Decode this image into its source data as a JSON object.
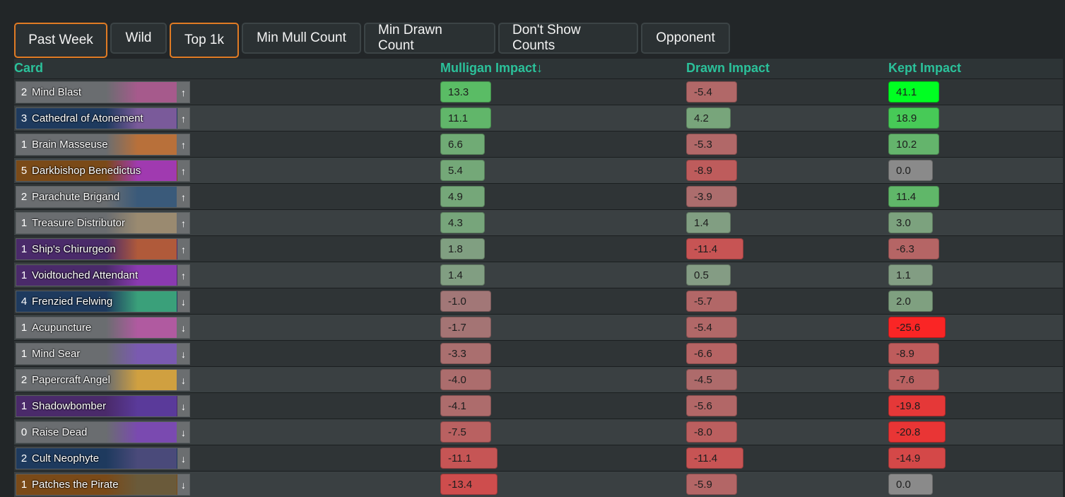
{
  "filters": [
    {
      "label": "Past Week",
      "active": true
    },
    {
      "label": "Wild",
      "active": false
    },
    {
      "label": "Top 1k",
      "active": true
    },
    {
      "label": "Min Mull Count",
      "active": false
    },
    {
      "label": "Min Drawn Count",
      "active": false
    },
    {
      "label": "Don't Show Counts",
      "active": false
    },
    {
      "label": "Opponent",
      "active": false
    }
  ],
  "headers": {
    "card": "Card",
    "mulligan": "Mulligan Impact↓",
    "drawn": "Drawn Impact",
    "kept": "Kept Impact"
  },
  "rows": [
    {
      "cost": "2",
      "name": "Mind Blast",
      "arrow": "↑",
      "card_bg": "#6a6d70",
      "art": "#a65a8c",
      "mulligan": "13.3",
      "drawn": "-5.4",
      "kept": "41.1"
    },
    {
      "cost": "3",
      "name": "Cathedral of Atonement",
      "arrow": "↑",
      "card_bg": "#1e3a5e",
      "art": "#7a5a9a",
      "mulligan": "11.1",
      "drawn": "4.2",
      "kept": "18.9"
    },
    {
      "cost": "1",
      "name": "Brain Masseuse",
      "arrow": "↑",
      "card_bg": "#6a6d70",
      "art": "#b8703a",
      "mulligan": "6.6",
      "drawn": "-5.3",
      "kept": "10.2"
    },
    {
      "cost": "5",
      "name": "Darkbishop Benedictus",
      "arrow": "↑",
      "card_bg": "#7a4a18",
      "art": "#a03ab0",
      "mulligan": "5.4",
      "drawn": "-8.9",
      "kept": "0.0"
    },
    {
      "cost": "2",
      "name": "Parachute Brigand",
      "arrow": "↑",
      "card_bg": "#6a6d70",
      "art": "#3a5a7a",
      "mulligan": "4.9",
      "drawn": "-3.9",
      "kept": "11.4"
    },
    {
      "cost": "1",
      "name": "Treasure Distributor",
      "arrow": "↑",
      "card_bg": "#6a6d70",
      "art": "#9a8a70",
      "mulligan": "4.3",
      "drawn": "1.4",
      "kept": "3.0"
    },
    {
      "cost": "1",
      "name": "Ship's Chirurgeon",
      "arrow": "↑",
      "card_bg": "#4a2a6a",
      "art": "#b05a3a",
      "mulligan": "1.8",
      "drawn": "-11.4",
      "kept": "-6.3"
    },
    {
      "cost": "1",
      "name": "Voidtouched Attendant",
      "arrow": "↑",
      "card_bg": "#4a2a6a",
      "art": "#8a3ab0",
      "mulligan": "1.4",
      "drawn": "0.5",
      "kept": "1.1"
    },
    {
      "cost": "4",
      "name": "Frenzied Felwing",
      "arrow": "↓",
      "card_bg": "#1e3a5e",
      "art": "#3aa07a",
      "mulligan": "-1.0",
      "drawn": "-5.7",
      "kept": "2.0"
    },
    {
      "cost": "1",
      "name": "Acupuncture",
      "arrow": "↓",
      "card_bg": "#6a6d70",
      "art": "#b05aa0",
      "mulligan": "-1.7",
      "drawn": "-5.4",
      "kept": "-25.6"
    },
    {
      "cost": "1",
      "name": "Mind Sear",
      "arrow": "↓",
      "card_bg": "#6a6d70",
      "art": "#7a5ab0",
      "mulligan": "-3.3",
      "drawn": "-6.6",
      "kept": "-8.9"
    },
    {
      "cost": "2",
      "name": "Papercraft Angel",
      "arrow": "↓",
      "card_bg": "#6a6d70",
      "art": "#d0a040",
      "mulligan": "-4.0",
      "drawn": "-4.5",
      "kept": "-7.6"
    },
    {
      "cost": "1",
      "name": "Shadowbomber",
      "arrow": "↓",
      "card_bg": "#4a2a6a",
      "art": "#5a3a9a",
      "mulligan": "-4.1",
      "drawn": "-5.6",
      "kept": "-19.8"
    },
    {
      "cost": "0",
      "name": "Raise Dead",
      "arrow": "↓",
      "card_bg": "#6a6d70",
      "art": "#7a4ab0",
      "mulligan": "-7.5",
      "drawn": "-8.0",
      "kept": "-20.8"
    },
    {
      "cost": "2",
      "name": "Cult Neophyte",
      "arrow": "↓",
      "card_bg": "#1e3a5e",
      "art": "#4a4a7a",
      "mulligan": "-11.1",
      "drawn": "-11.4",
      "kept": "-14.9"
    },
    {
      "cost": "1",
      "name": "Patches the Pirate",
      "arrow": "↓",
      "card_bg": "#7a4a18",
      "art": "#6a5a3a",
      "mulligan": "-13.4",
      "drawn": "-5.9",
      "kept": "0.0"
    }
  ],
  "colors": {
    "header_text": "#2bc19a",
    "active_border": "#e07b24",
    "positive": "#00ff00",
    "negative": "#ff1a1a",
    "neutral": "#8a8a8a"
  }
}
